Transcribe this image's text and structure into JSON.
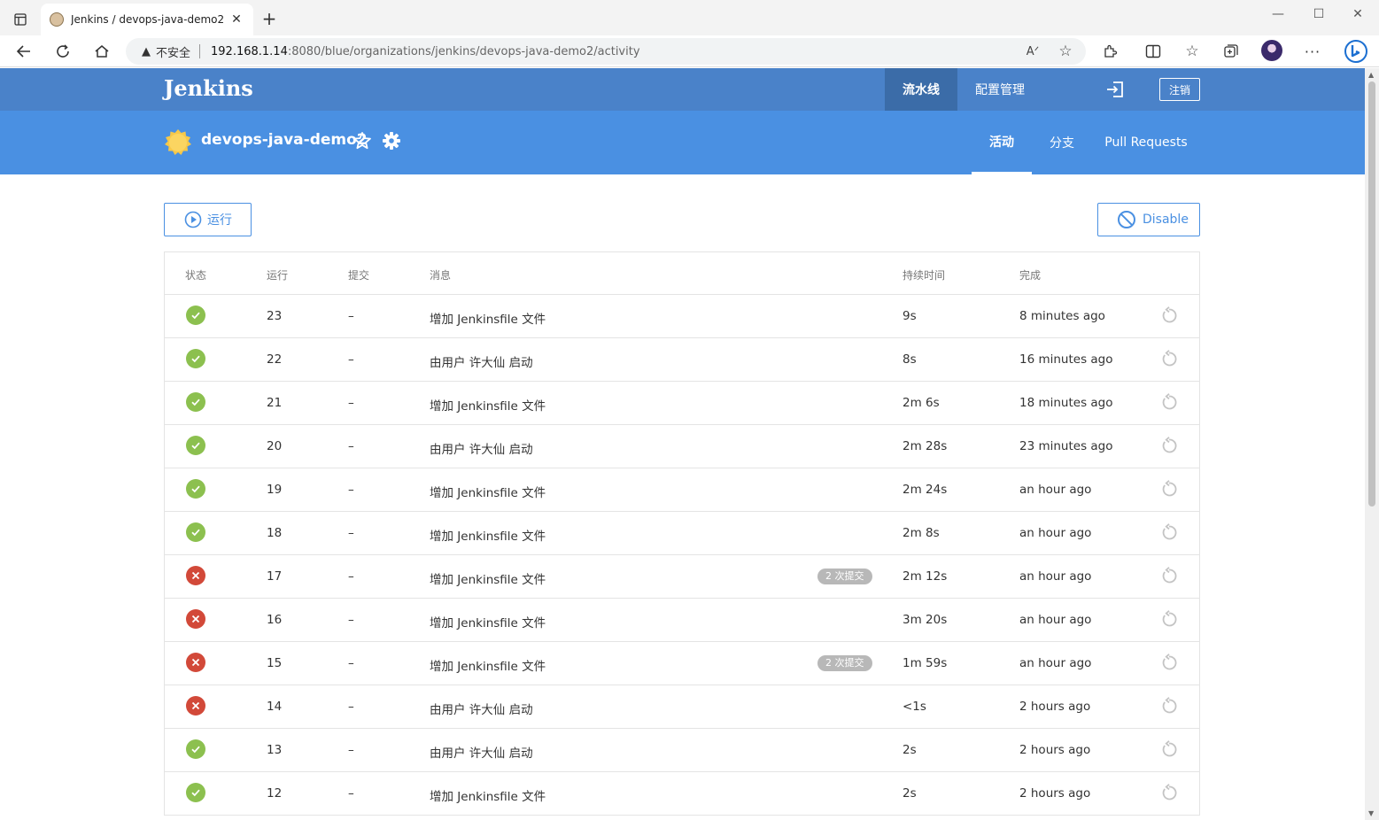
{
  "browser": {
    "tab_title": "Jenkins / devops-java-demo2",
    "address_insecure": "不安全",
    "address_host": "192.168.1.14",
    "address_path": ":8080/blue/organizations/jenkins/devops-java-demo2/activity"
  },
  "header": {
    "logo": "Jenkins",
    "nav_pipelines": "流水线",
    "nav_admin": "配置管理",
    "signout": "注销"
  },
  "project": {
    "name": "devops-java-demo2",
    "tabs": [
      "活动",
      "分支",
      "Pull Requests"
    ]
  },
  "actions": {
    "run": "运行",
    "disable": "Disable"
  },
  "table": {
    "headers": [
      "状态",
      "运行",
      "提交",
      "消息",
      "持续时间",
      "完成"
    ],
    "rows": [
      {
        "status": "success",
        "run": "23",
        "commit": "–",
        "message": "增加 Jenkinsfile 文件",
        "badge": "",
        "duration": "9s",
        "completed": "8 minutes ago"
      },
      {
        "status": "success",
        "run": "22",
        "commit": "–",
        "message": "由用户 许大仙 启动",
        "badge": "",
        "duration": "8s",
        "completed": "16 minutes ago"
      },
      {
        "status": "success",
        "run": "21",
        "commit": "–",
        "message": "增加 Jenkinsfile 文件",
        "badge": "",
        "duration": "2m 6s",
        "completed": "18 minutes ago"
      },
      {
        "status": "success",
        "run": "20",
        "commit": "–",
        "message": "由用户 许大仙 启动",
        "badge": "",
        "duration": "2m 28s",
        "completed": "23 minutes ago"
      },
      {
        "status": "success",
        "run": "19",
        "commit": "–",
        "message": "增加 Jenkinsfile 文件",
        "badge": "",
        "duration": "2m 24s",
        "completed": "an hour ago"
      },
      {
        "status": "success",
        "run": "18",
        "commit": "–",
        "message": "增加 Jenkinsfile 文件",
        "badge": "",
        "duration": "2m 8s",
        "completed": "an hour ago"
      },
      {
        "status": "failure",
        "run": "17",
        "commit": "–",
        "message": "增加 Jenkinsfile 文件",
        "badge": "2 次提交",
        "duration": "2m 12s",
        "completed": "an hour ago"
      },
      {
        "status": "failure",
        "run": "16",
        "commit": "–",
        "message": "增加 Jenkinsfile 文件",
        "badge": "",
        "duration": "3m 20s",
        "completed": "an hour ago"
      },
      {
        "status": "failure",
        "run": "15",
        "commit": "–",
        "message": "增加 Jenkinsfile 文件",
        "badge": "2 次提交",
        "duration": "1m 59s",
        "completed": "an hour ago"
      },
      {
        "status": "failure",
        "run": "14",
        "commit": "–",
        "message": "由用户 许大仙 启动",
        "badge": "",
        "duration": "<1s",
        "completed": "2 hours ago"
      },
      {
        "status": "success",
        "run": "13",
        "commit": "–",
        "message": "由用户 许大仙 启动",
        "badge": "",
        "duration": "2s",
        "completed": "2 hours ago"
      },
      {
        "status": "success",
        "run": "12",
        "commit": "–",
        "message": "增加 Jenkinsfile 文件",
        "badge": "",
        "duration": "2s",
        "completed": "2 hours ago"
      }
    ]
  },
  "colors": {
    "header_dark": "#4a82c9",
    "header_light": "#4a90e2",
    "success": "#8cc04f",
    "failure": "#d24939",
    "accent": "#4a90e2"
  }
}
